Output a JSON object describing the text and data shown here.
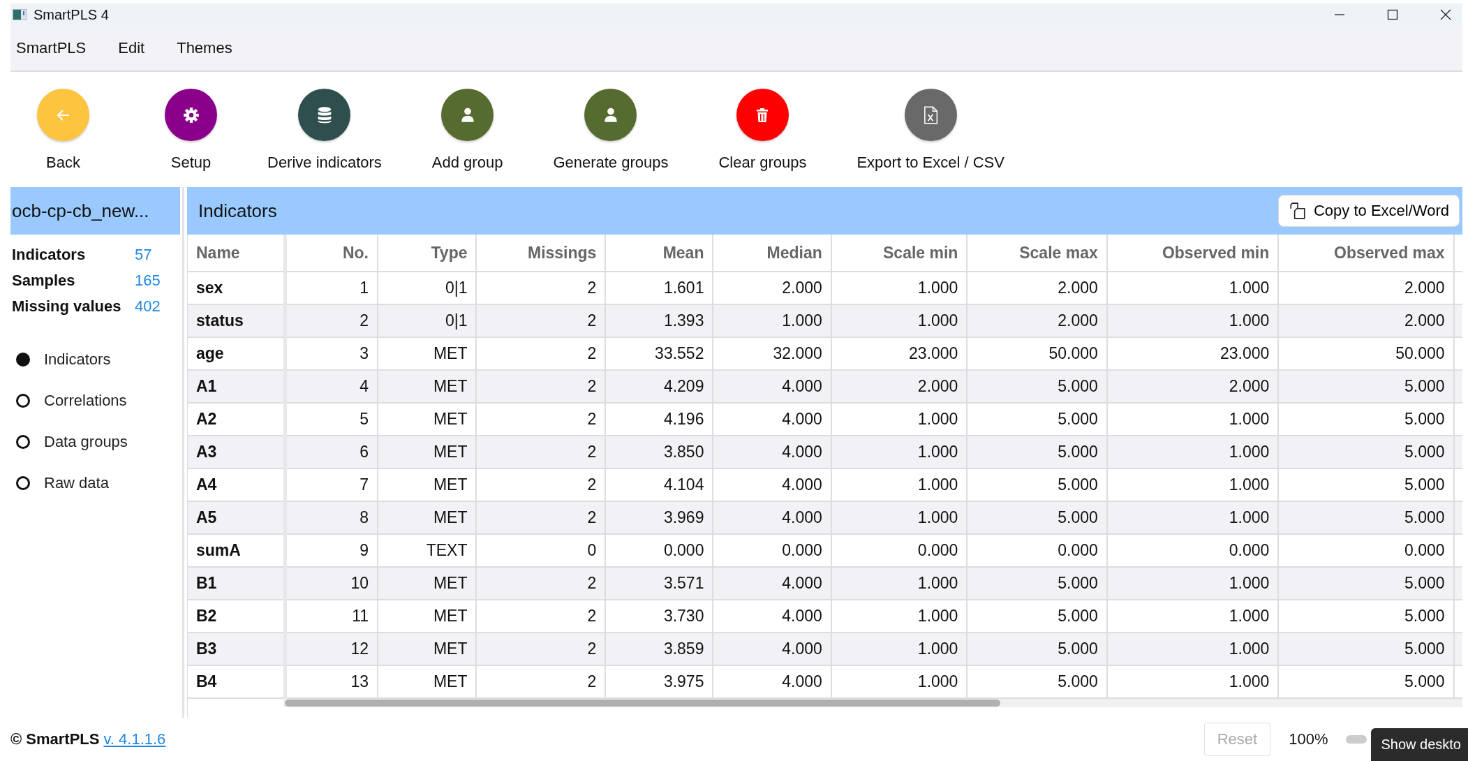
{
  "window": {
    "title": "SmartPLS 4"
  },
  "menu": [
    "SmartPLS",
    "Edit",
    "Themes"
  ],
  "toolbar": [
    {
      "label": "Back",
      "kind": "back",
      "color": "#fdc53f"
    },
    {
      "label": "Setup",
      "kind": "setup",
      "color": "#8b008b"
    },
    {
      "label": "Derive indicators",
      "kind": "database",
      "color": "#2f4f4f"
    },
    {
      "label": "Add group",
      "kind": "person",
      "color": "#556b2f"
    },
    {
      "label": "Generate groups",
      "kind": "person",
      "color": "#556b2f"
    },
    {
      "label": "Clear groups",
      "kind": "trash",
      "color": "#ff0000"
    },
    {
      "label": "Export to Excel / CSV",
      "kind": "excel",
      "color": "#696969"
    }
  ],
  "sidebar": {
    "title": "ocb-cp-cb_new...",
    "stats": [
      {
        "label": "Indicators",
        "value": "57"
      },
      {
        "label": "Samples",
        "value": "165"
      },
      {
        "label": "Missing values",
        "value": "402"
      }
    ],
    "views": [
      {
        "label": "Indicators",
        "selected": true
      },
      {
        "label": "Correlations",
        "selected": false
      },
      {
        "label": "Data groups",
        "selected": false
      },
      {
        "label": "Raw data",
        "selected": false
      }
    ]
  },
  "panel": {
    "title": "Indicators",
    "copy_button": "Copy to Excel/Word"
  },
  "table": {
    "columns": [
      "Name",
      "No.",
      "Type",
      "Missings",
      "Mean",
      "Median",
      "Scale min",
      "Scale max",
      "Observed min",
      "Observed max"
    ],
    "rows": [
      [
        "sex",
        "1",
        "0|1",
        "2",
        "1.601",
        "2.000",
        "1.000",
        "2.000",
        "1.000",
        "2.000"
      ],
      [
        "status",
        "2",
        "0|1",
        "2",
        "1.393",
        "1.000",
        "1.000",
        "2.000",
        "1.000",
        "2.000"
      ],
      [
        "age",
        "3",
        "MET",
        "2",
        "33.552",
        "32.000",
        "23.000",
        "50.000",
        "23.000",
        "50.000"
      ],
      [
        "A1",
        "4",
        "MET",
        "2",
        "4.209",
        "4.000",
        "2.000",
        "5.000",
        "2.000",
        "5.000"
      ],
      [
        "A2",
        "5",
        "MET",
        "2",
        "4.196",
        "4.000",
        "1.000",
        "5.000",
        "1.000",
        "5.000"
      ],
      [
        "A3",
        "6",
        "MET",
        "2",
        "3.850",
        "4.000",
        "1.000",
        "5.000",
        "1.000",
        "5.000"
      ],
      [
        "A4",
        "7",
        "MET",
        "2",
        "4.104",
        "4.000",
        "1.000",
        "5.000",
        "1.000",
        "5.000"
      ],
      [
        "A5",
        "8",
        "MET",
        "2",
        "3.969",
        "4.000",
        "1.000",
        "5.000",
        "1.000",
        "5.000"
      ],
      [
        "sumA",
        "9",
        "TEXT",
        "0",
        "0.000",
        "0.000",
        "0.000",
        "0.000",
        "0.000",
        "0.000"
      ],
      [
        "B1",
        "10",
        "MET",
        "2",
        "3.571",
        "4.000",
        "1.000",
        "5.000",
        "1.000",
        "5.000"
      ],
      [
        "B2",
        "11",
        "MET",
        "2",
        "3.730",
        "4.000",
        "1.000",
        "5.000",
        "1.000",
        "5.000"
      ],
      [
        "B3",
        "12",
        "MET",
        "2",
        "3.859",
        "4.000",
        "1.000",
        "5.000",
        "1.000",
        "5.000"
      ],
      [
        "B4",
        "13",
        "MET",
        "2",
        "3.975",
        "4.000",
        "1.000",
        "5.000",
        "1.000",
        "5.000"
      ]
    ]
  },
  "footer": {
    "copyright": "© SmartPLS",
    "version": "v. 4.1.1.6",
    "reset": {
      "label": "Reset",
      "disabled": true
    },
    "zoom": "100%",
    "tooltip": "Show deskto"
  }
}
